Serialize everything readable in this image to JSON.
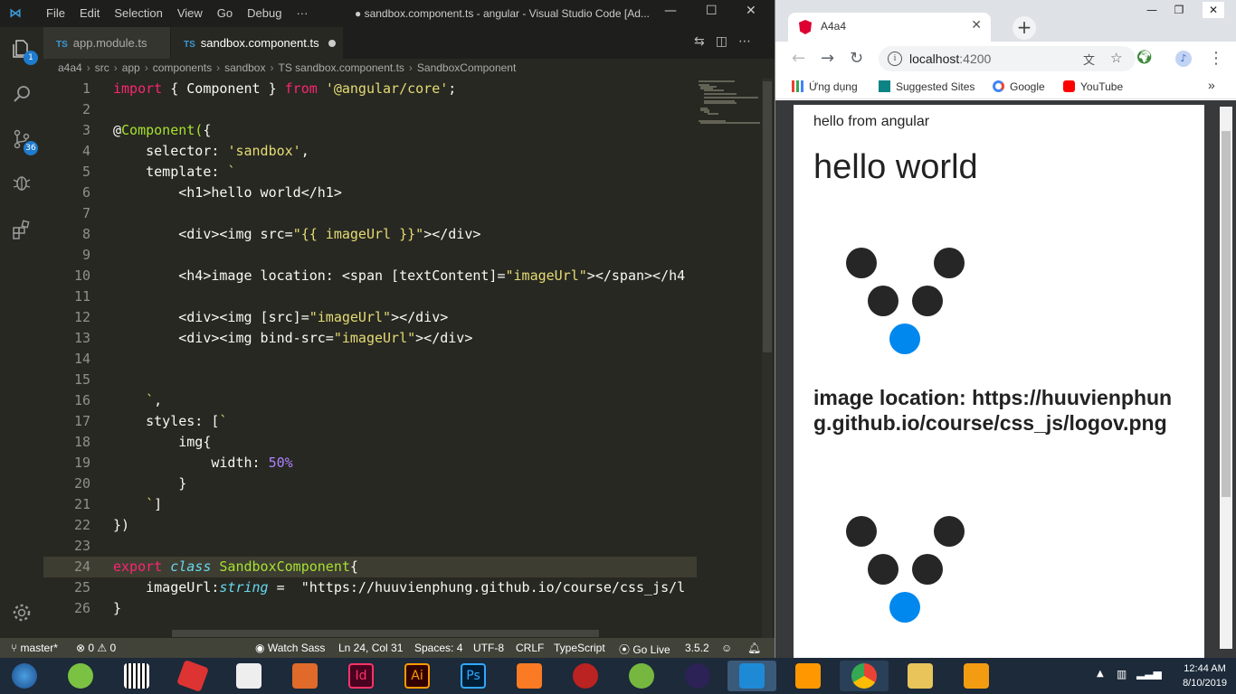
{
  "vscode": {
    "menu": [
      "File",
      "Edit",
      "Selection",
      "View",
      "Go",
      "Debug",
      "···"
    ],
    "window_title": "● sandbox.component.ts - angular - Visual Studio Code [Ad...",
    "activity_badges": {
      "explorer": "1",
      "scm": "36"
    },
    "tabs": [
      {
        "icon": "TS",
        "label": "app.module.ts"
      },
      {
        "icon": "TS",
        "label": "sandbox.component.ts"
      }
    ],
    "breadcrumbs": [
      "a4a4",
      "src",
      "app",
      "components",
      "sandbox",
      "TS sandbox.component.ts",
      "SandboxComponent"
    ],
    "code_lines": [
      {
        "n": "1",
        "text": "import { Component } from '@angular/core';"
      },
      {
        "n": "2",
        "text": ""
      },
      {
        "n": "3",
        "text": "@Component({"
      },
      {
        "n": "4",
        "text": "    selector: 'sandbox',"
      },
      {
        "n": "5",
        "text": "    template: `"
      },
      {
        "n": "6",
        "text": "        <h1>hello world</h1>"
      },
      {
        "n": "7",
        "text": ""
      },
      {
        "n": "8",
        "text": "        <div><img src=\"{{ imageUrl }}\"></div>"
      },
      {
        "n": "9",
        "text": ""
      },
      {
        "n": "10",
        "text": "        <h4>image location: <span [textContent]=\"imageUrl\"></span></h4"
      },
      {
        "n": "11",
        "text": ""
      },
      {
        "n": "12",
        "text": "        <div><img [src]=\"imageUrl\"></div>"
      },
      {
        "n": "13",
        "text": "        <div><img bind-src=\"imageUrl\"></div>"
      },
      {
        "n": "14",
        "text": ""
      },
      {
        "n": "15",
        "text": ""
      },
      {
        "n": "16",
        "text": "    `,"
      },
      {
        "n": "17",
        "text": "    styles: [`"
      },
      {
        "n": "18",
        "text": "        img{"
      },
      {
        "n": "19",
        "text": "            width: 50%"
      },
      {
        "n": "20",
        "text": "        }"
      },
      {
        "n": "21",
        "text": "    `]"
      },
      {
        "n": "22",
        "text": "})"
      },
      {
        "n": "23",
        "text": ""
      },
      {
        "n": "24",
        "text": "export class SandboxComponent{"
      },
      {
        "n": "25",
        "text": "    imageUrl:string =  \"https://huuvienphung.github.io/course/css_js/l"
      },
      {
        "n": "26",
        "text": "}"
      }
    ],
    "current_line": "24",
    "status": {
      "branch": "master*",
      "problems": "⊗ 0 ⚠ 0",
      "watch_sass": "Watch Sass",
      "position": "Ln 24, Col 31",
      "spaces": "Spaces: 4",
      "encoding": "UTF-8",
      "eol": "CRLF",
      "language": "TypeScript",
      "go_live": "Go Live",
      "version": "3.5.2"
    }
  },
  "chrome": {
    "tab_title": "A4a4",
    "url_host": "localhost",
    "url_port": ":4200",
    "bookmarks": [
      "Ứng dụng",
      "Suggested Sites",
      "Google",
      "YouTube"
    ],
    "page": {
      "text": "hello from angular",
      "h1": "hello world",
      "h4": "image location: https://huuvienphung.github.io/course/css_js/logov.png"
    }
  },
  "taskbar": {
    "time": "12:44 AM",
    "date": "8/10/2019"
  },
  "colors": {
    "editor_bg": "#272822",
    "keyword": "#f92672",
    "string": "#e6db74",
    "function": "#a6e22e",
    "logo_accent": "#0088ee"
  }
}
